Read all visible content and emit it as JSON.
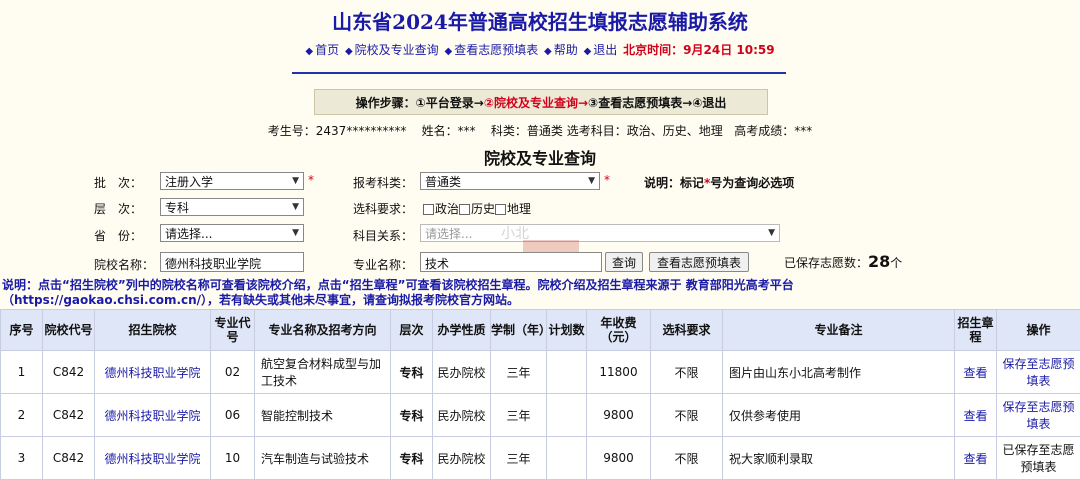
{
  "header": {
    "title": "山东省2024年普通高校招生填报志愿辅助系统"
  },
  "nav": {
    "items": [
      "首页",
      "院校及专业查询",
      "查看志愿预填表",
      "帮助",
      "退出"
    ],
    "time_label": "北京时间：9月24日 10:59"
  },
  "steps": {
    "label": "操作步骤：",
    "items": [
      "①平台登录→",
      "②院校及专业查询→",
      "③查看志愿预填表→",
      "④退出"
    ],
    "active_index": 1
  },
  "candidate": {
    "id": "考生号：2437**********",
    "name": "姓名：***",
    "category": "科类：普通类",
    "subjects": "选考科目：政治、历史、地理",
    "score": "高考成绩：***"
  },
  "form": {
    "heading": "院校及专业查询",
    "batch_label": "批　次：",
    "batch_value": "注册入学",
    "subject_type_label": "报考科类：",
    "subject_type_value": "普通类",
    "level_label": "层　次：",
    "level_value": "专科",
    "requirement_label": "选科要求：",
    "requirement_options": [
      "政治",
      "历史",
      "地理"
    ],
    "province_label": "省　份：",
    "province_value": "请选择...",
    "relation_label": "科目关系：",
    "relation_value": "请选择...",
    "school_label": "院校名称：",
    "school_value": "德州科技职业学院",
    "major_label": "专业名称：",
    "major_value": "技术",
    "query_button": "查询",
    "view_button": "查看志愿预填表",
    "note_prefix": "说明：标记",
    "note_star": "*",
    "note_suffix": "号为查询必选项",
    "required_mark": "*",
    "saved_prefix": "已保存志愿数：",
    "saved_count": "28",
    "saved_suffix": "个"
  },
  "description": {
    "line1_a": "说明：点击“招生院校”列中的院校名称可查看该院校介绍，点击“招生章程”可查看该院校招生章程。院校介绍及招生章程来源于 教育部阳光高考平台",
    "line2": "（https://gaokao.chsi.com.cn/），若有缺失或其他未尽事宜，请查询拟报考院校官方网站。"
  },
  "table": {
    "headers": [
      "序号",
      "院校代号",
      "招生院校",
      "专业代号",
      "专业名称及招考方向",
      "层次",
      "办学性质",
      "学制（年）",
      "计划数",
      "年收费（元）",
      "选科要求",
      "专业备注",
      "招生章程",
      "操作"
    ],
    "rows": [
      [
        "1",
        "C842",
        "德州科技职业学院",
        "02",
        "航空复合材料成型与加工技术",
        "专科",
        "民办院校",
        "三年",
        "",
        "11800",
        "不限",
        "图片由山东小北高考制作",
        "查看",
        "保存至志愿预填表"
      ],
      [
        "2",
        "C842",
        "德州科技职业学院",
        "06",
        "智能控制技术",
        "专科",
        "民办院校",
        "三年",
        "",
        "9800",
        "不限",
        "仅供参考使用",
        "查看",
        "保存至志愿预填表"
      ],
      [
        "3",
        "C842",
        "德州科技职业学院",
        "10",
        "汽车制造与试验技术",
        "专科",
        "民办院校",
        "三年",
        "",
        "9800",
        "不限",
        "祝大家顺利录取",
        "查看",
        "已保存至志愿预填表"
      ]
    ]
  },
  "colors": {
    "accent": "#1a1aa6",
    "alert": "#d0021b",
    "header_bg": "#dfe6f7",
    "page_bg": "#fffdf2"
  }
}
